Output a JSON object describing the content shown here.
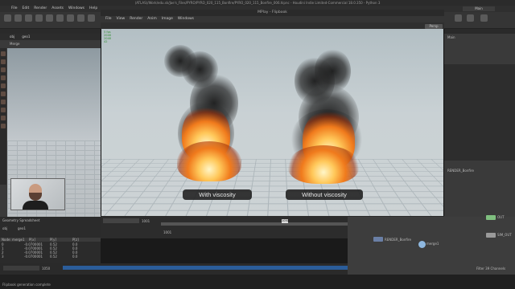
{
  "app": {
    "window_title": "(ATLAS)/Work/edu.sk/Jae's_Files/PYRO/PYRO_020_115_Bonfire/PYRO_020_115_Bonfire_006.hipnc - Houdini Indie Limited-Commercial 18.0.350 - Python 3",
    "menu": [
      "File",
      "Edit",
      "Render",
      "Assets",
      "Windows",
      "Help"
    ],
    "desktop_label": "Main"
  },
  "left_pane": {
    "path": "obj",
    "path_node": "geo1",
    "view_label": "Merge"
  },
  "mplay": {
    "title": "MPlay - Flipbook",
    "menu": [
      "File",
      "View",
      "Render",
      "Anim",
      "Image",
      "Windows"
    ],
    "persp_label": "Persp",
    "stats": [
      "5 fps",
      "2048",
      "2048",
      "42"
    ],
    "label_left": "With viscosity",
    "label_right": "Without viscosity",
    "frame_start": "1001",
    "frame_current": "1050",
    "frame_end": "1250"
  },
  "bottom_left": {
    "tab": "Geometry Spreadsheet",
    "node": "obj",
    "sub": "geo1",
    "columns": [
      "Node: merge1",
      "P[x]",
      "P[y]",
      "P[z]"
    ],
    "rows": [
      [
        "0",
        "-0.0700001",
        "0.52",
        "0.0"
      ],
      [
        "1",
        "-0.0700001",
        "0.52",
        "0.0"
      ],
      [
        "2",
        "-0.0700001",
        "0.52",
        "0.0"
      ],
      [
        "3",
        "-0.0700001",
        "0.52",
        "0.0"
      ]
    ]
  },
  "network": {
    "nodes": [
      "RENDER_Bonfire",
      "merge1",
      "OUT",
      "SIM_OUT",
      "null1"
    ]
  },
  "main_timeline": {
    "start": "1001",
    "current": "1050",
    "end": "1250",
    "range_start": "1001",
    "range_end": "1250"
  },
  "status": {
    "message": "Flipbook generation complete"
  },
  "right_pane": {
    "tab": "Main",
    "node_name": "RENDER_Bonfire",
    "channels_label": "Filter 39 Channels",
    "auto_update": "Auto Update"
  }
}
